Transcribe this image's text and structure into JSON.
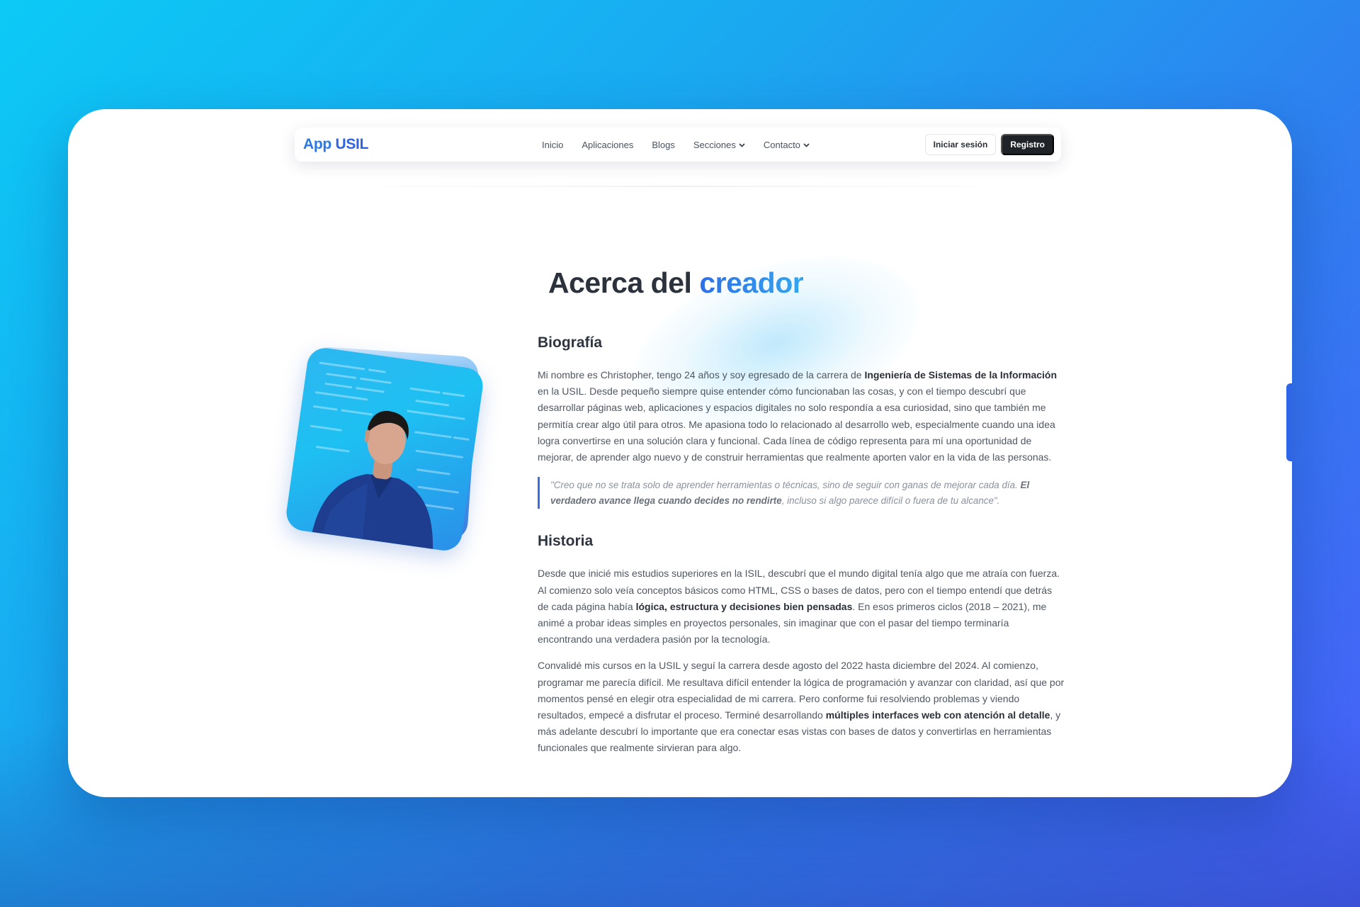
{
  "nav": {
    "logo_part1": "App",
    "logo_part2": "USIL",
    "links": {
      "inicio": "Inicio",
      "aplicaciones": "Aplicaciones",
      "blogs": "Blogs",
      "secciones": "Secciones",
      "contacto": "Contacto"
    },
    "login_label": "Iniciar sesión",
    "register_label": "Registro"
  },
  "hero": {
    "title_main": "Acerca del",
    "title_accent": "creador"
  },
  "biografia": {
    "heading": "Biografía",
    "p1_a": "Mi nombre es Christopher, tengo 24 años y soy egresado de la carrera de ",
    "p1_b": "Ingeniería de Sistemas de la Información",
    "p1_c": " en la USIL. Desde pequeño siempre quise entender cómo funcionaban las cosas, y con el tiempo descubrí que desarrollar páginas web, aplicaciones y espacios digitales no solo respondía a esa curiosidad, sino que también me permitía crear algo útil para otros. Me apasiona todo lo relacionado al desarrollo web, especialmente cuando una idea logra convertirse en una solución clara y funcional. Cada línea de código representa para mí una oportunidad de mejorar, de aprender algo nuevo y de construir herramientas que realmente aporten valor en la vida de las personas.",
    "quote_a": "\"Creo que no se trata solo de aprender herramientas o técnicas, sino de seguir con ganas de mejorar cada día. ",
    "quote_b": "El verdadero avance llega cuando decides no rendirte",
    "quote_c": ", incluso si algo parece difícil o fuera de tu alcance\"."
  },
  "historia": {
    "heading": "Historia",
    "p1_a": "Desde que inicié mis estudios superiores en la ISIL, descubrí que el mundo digital tenía algo que me atraía con fuerza. Al comienzo solo veía conceptos básicos como HTML, CSS o bases de datos, pero con el tiempo entendí que detrás de cada página había ",
    "p1_b": "lógica, estructura y decisiones bien pensadas",
    "p1_c": ". En esos primeros ciclos (2018 – 2021), me animé a probar ideas simples en proyectos personales, sin imaginar que con el pasar del tiempo terminaría encontrando una verdadera pasión por la tecnología.",
    "p2_a": "Convalidé mis cursos en la USIL y seguí la carrera desde agosto del 2022 hasta diciembre del 2024. Al comienzo, programar me parecía difícil. Me resultava difícil entender la lógica de programación y avanzar con claridad, así que por momentos pensé en elegir otra especialidad de mi carrera. Pero conforme fui resolviendo problemas y viendo resultados, empecé a disfrutar el proceso. Terminé desarrollando ",
    "p2_b": "múltiples interfaces web con atención al detalle",
    "p2_c": ", y más adelante descubrí lo importante que era conectar esas vistas con bases de datos y convertirlas en herramientas funcionales que realmente sirvieran para algo."
  }
}
